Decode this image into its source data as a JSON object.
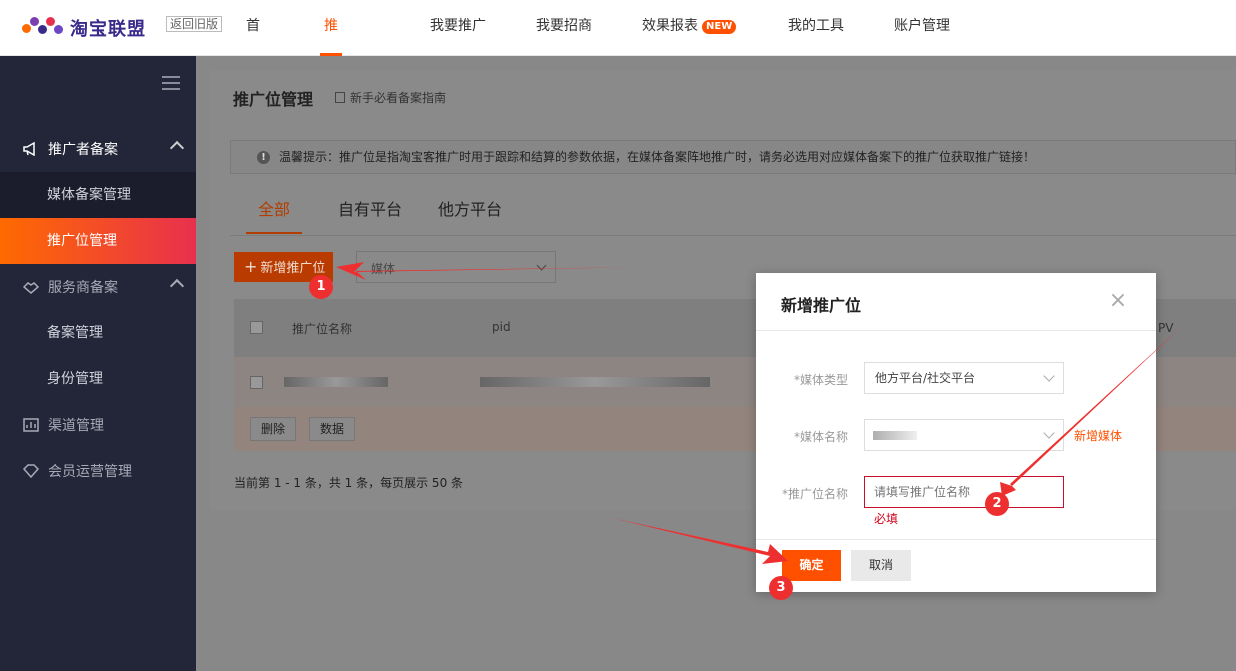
{
  "brand": {
    "logo_text": "淘宝联盟",
    "old_version": "返回旧版"
  },
  "nav": {
    "items": [
      "首页",
      "推广管理",
      "我要推广",
      "我要招商",
      "效果报表",
      "我的工具",
      "账户管理"
    ],
    "active": "推广管理",
    "badge": "NEW"
  },
  "sidebar": {
    "group1": "推广者备案",
    "group1_items": [
      "媒体备案管理",
      "推广位管理"
    ],
    "group2": "服务商备案",
    "group2_items": [
      "备案管理",
      "身份管理"
    ],
    "group3": "渠道管理",
    "group4": "会员运营管理",
    "active_item": "推广位管理"
  },
  "main": {
    "title": "推广位管理",
    "guide_link": "新手必看备案指南",
    "tip": "温馨提示：推广位是指淘宝客推广时用于跟踪和结算的参数依据，在媒体备案阵地推广时，请务必选用对应媒体备案下的推广位获取推广链接！",
    "tabs": [
      "全部",
      "自有平台",
      "他方平台"
    ],
    "add_button": "新增推广位",
    "filter_value": "媒体",
    "table": {
      "columns": [
        "推广位名称",
        "pid",
        "PV"
      ],
      "delete_btn": "删除",
      "data_btn": "数据"
    },
    "pager": "当前第 1 - 1 条，共 1 条，每页展示 50 条"
  },
  "modal": {
    "title": "新增推广位",
    "media_type_label": "*媒体类型",
    "media_type_value": "他方平台/社交平台",
    "media_name_label": "*媒体名称",
    "new_media_link": "新增媒体",
    "placement_label": "*推广位名称",
    "placement_placeholder": "请填写推广位名称",
    "required_msg": "必填",
    "confirm": "确定",
    "cancel": "取消"
  },
  "annotations": [
    "1",
    "2",
    "3"
  ],
  "colors": {
    "accent": "#ff5000",
    "sidebar_bg": "#232638",
    "arrow": "#ee2f2f"
  }
}
